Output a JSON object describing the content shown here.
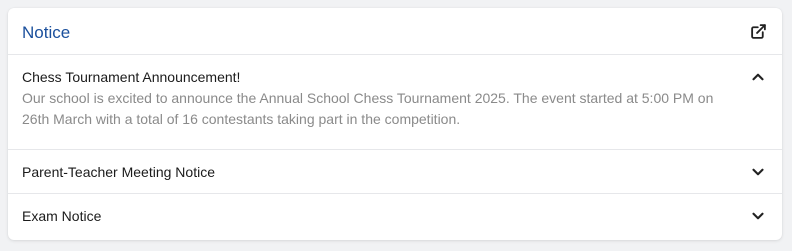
{
  "notice": {
    "title": "Notice",
    "external_link_icon": "external-link-icon",
    "items": [
      {
        "title": "Chess Tournament Announcement!",
        "body": "Our school is excited to announce the Annual School Chess Tournament 2025. The event started at 5:00 PM on 26th March with a total of 16 contestants taking part in the competition.",
        "expanded": true,
        "toggle_icon": "chevron-up-icon"
      },
      {
        "title": "Parent-Teacher Meeting Notice",
        "expanded": false,
        "toggle_icon": "chevron-down-icon"
      },
      {
        "title": "Exam Notice",
        "expanded": false,
        "toggle_icon": "chevron-down-icon"
      }
    ]
  },
  "colors": {
    "title": "#1a4f9c",
    "body_text": "#8a8a8a",
    "heading_text": "#1b1b1b",
    "background": "#f1f2f4",
    "card": "#ffffff"
  }
}
